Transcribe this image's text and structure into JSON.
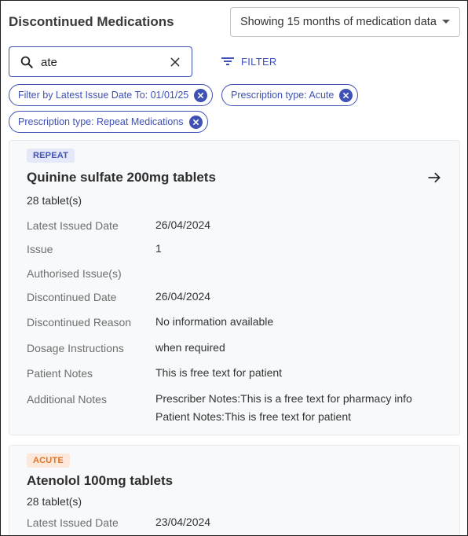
{
  "header": {
    "title": "Discontinued Medications",
    "range_select": "Showing 15 months of medication data"
  },
  "search": {
    "value": "ate",
    "icon": "search-icon",
    "clear_icon": "close-icon"
  },
  "filter_button": {
    "label": "FILTER",
    "icon": "filter-list-icon"
  },
  "chips": [
    {
      "label": "Filter by Latest Issue Date To: 01/01/25"
    },
    {
      "label": "Prescription type: Acute"
    },
    {
      "label": "Prescription type: Repeat Medications"
    }
  ],
  "colors": {
    "accent": "#3f51b5",
    "repeat_badge_bg": "#e4e8f8",
    "acute_badge_bg": "#fde9dc",
    "acute_badge_text": "#e0732a",
    "card_bg": "#f7f9fb"
  },
  "cards": [
    {
      "badge": "REPEAT",
      "name": "Quinine sulfate 200mg tablets",
      "quantity": "28 tablet(s)",
      "rows": [
        {
          "label": "Latest Issued Date",
          "value": "26/04/2024"
        },
        {
          "label": "Issue",
          "value": "1"
        },
        {
          "label": "Authorised Issue(s)",
          "value": ""
        },
        {
          "label": "Discontinued Date",
          "value": "26/04/2024"
        },
        {
          "label": "Discontinued Reason",
          "value": "No information available"
        },
        {
          "label": "Dosage Instructions",
          "value": "when required"
        },
        {
          "label": "Patient Notes",
          "value": "This is free text for patient"
        },
        {
          "label": "Additional Notes",
          "value": "Prescriber Notes:This is a free text for pharmacy info",
          "value2": "Patient Notes:This is free text for patient"
        }
      ]
    },
    {
      "badge": "ACUTE",
      "name": "Atenolol 100mg tablets",
      "quantity": "28 tablet(s)",
      "rows": [
        {
          "label": "Latest Issued Date",
          "value": "23/04/2024"
        }
      ]
    }
  ]
}
